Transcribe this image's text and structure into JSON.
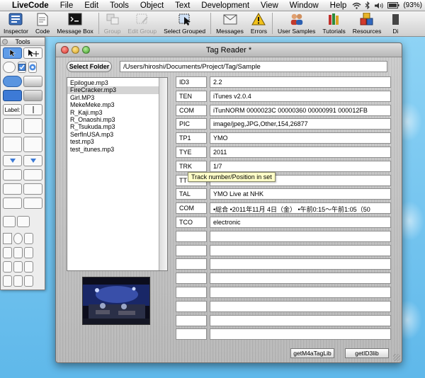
{
  "menubar": {
    "items": [
      "LiveCode",
      "File",
      "Edit",
      "Tools",
      "Object",
      "Text",
      "Development",
      "View",
      "Window",
      "Help"
    ],
    "battery": "(93%)"
  },
  "toolbar": {
    "buttons": [
      {
        "label": "Inspector",
        "enabled": true
      },
      {
        "label": "Code",
        "enabled": true
      },
      {
        "label": "Message Box",
        "enabled": true
      },
      {
        "label": "Group",
        "enabled": false
      },
      {
        "label": "Edit Group",
        "enabled": false
      },
      {
        "label": "Select Grouped",
        "enabled": true
      },
      {
        "label": "Messages",
        "enabled": true
      },
      {
        "label": "Errors",
        "enabled": true
      },
      {
        "label": "User Samples",
        "enabled": true
      },
      {
        "label": "Tutorials",
        "enabled": true
      },
      {
        "label": "Resources",
        "enabled": true
      },
      {
        "label": "Di",
        "enabled": true
      }
    ]
  },
  "tools_palette": {
    "title": "Tools",
    "label_tool": "Label:"
  },
  "window": {
    "title": "Tag Reader *",
    "select_folder_label": "Select Folder",
    "folder_path": "/Users/hiroshi/Documents/Project/Tag/Sample",
    "files": [
      "Epilogue.mp3",
      "FireCracker.mp3",
      "Girl.MP3",
      "MekeMeke.mp3",
      "R_Kaji.mp3",
      "R_Onaoshi.mp3",
      "R_Tsukuda.mp3",
      "SerfInUSA.mp3",
      "test.mp3",
      "test_itunes.mp3"
    ],
    "selected_file": "FireCracker.mp3",
    "tags": [
      {
        "id": "ID3",
        "value": "2.2"
      },
      {
        "id": "TEN",
        "value": "iTunes v2.0.4"
      },
      {
        "id": "COM",
        "value": "iTunNORM 0000023C 00000360 00000991 000012FB"
      },
      {
        "id": "PIC",
        "value": "image/jpeg,JPG,Other,154,26877"
      },
      {
        "id": "TP1",
        "value": "YMO"
      },
      {
        "id": "TYE",
        "value": "2011"
      },
      {
        "id": "TRK",
        "value": "1/7"
      },
      {
        "id": "TT",
        "value": ""
      },
      {
        "id": "TAL",
        "value": "YMO Live at NHK"
      },
      {
        "id": "COM",
        "value": "•総合 •2011年11月 4日（金） •午前0:15〜午前1:05（50"
      },
      {
        "id": "TCO",
        "value": "electronic"
      },
      {
        "id": "",
        "value": ""
      },
      {
        "id": "",
        "value": ""
      },
      {
        "id": "",
        "value": ""
      },
      {
        "id": "",
        "value": ""
      },
      {
        "id": "",
        "value": ""
      },
      {
        "id": "",
        "value": ""
      },
      {
        "id": "",
        "value": ""
      },
      {
        "id": "",
        "value": ""
      }
    ],
    "tooltip": "Track number/Position in set",
    "buttons": {
      "get_m4a": "getM4aTagLib",
      "get_id3": "getID3lib"
    }
  }
}
